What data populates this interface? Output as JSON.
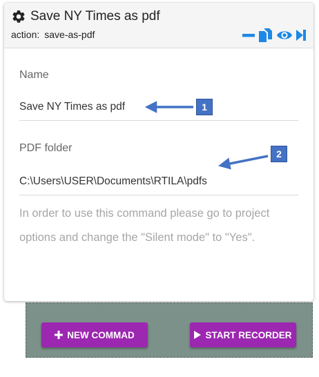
{
  "command": {
    "title": "Save NY Times as pdf",
    "action_label": "action:",
    "action_value": "save-as-pdf",
    "toolbar_icons": [
      "minus-icon",
      "copy-icon",
      "eye-icon",
      "skip-icon"
    ]
  },
  "fields": {
    "name": {
      "label": "Name",
      "value": "Save NY Times as pdf"
    },
    "pdf_folder": {
      "label": "PDF folder",
      "value": "C:\\Users\\USER\\Documents\\RTILA\\pdfs"
    }
  },
  "hint": "In order to use this command please go to project options and change the \"Silent mode\" to \"Yes\".",
  "annotations": {
    "badge1": "1",
    "badge2": "2"
  },
  "buttons": {
    "new_command": "NEW COMMAD",
    "start_recorder": "START RECORDER"
  },
  "colors": {
    "accent_blue": "#1e88e5",
    "button_purple": "#9c27b0",
    "annotation_blue": "#4472c4",
    "bar_background": "#7c9189"
  }
}
